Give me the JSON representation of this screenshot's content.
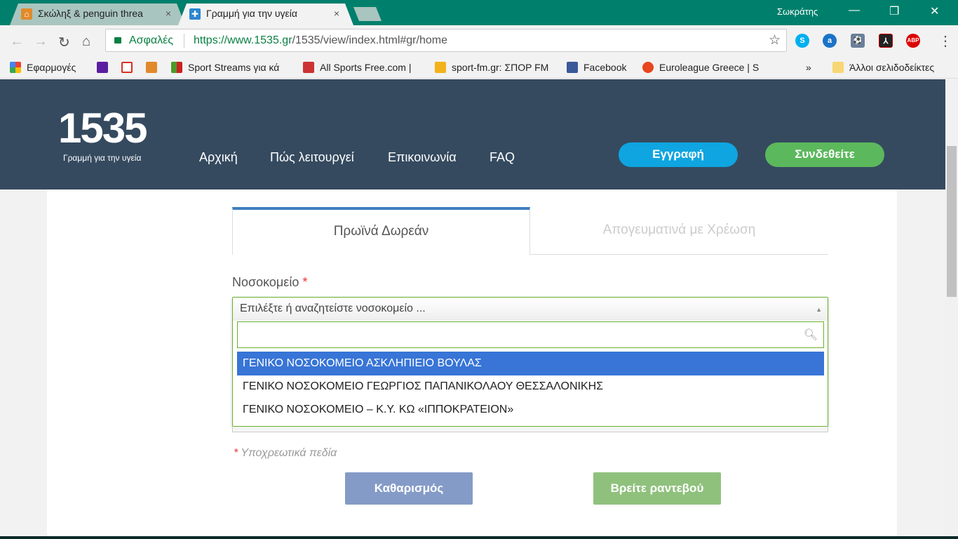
{
  "browser": {
    "tabs": [
      {
        "title": "Σκώληξ & penguin threa",
        "active": false
      },
      {
        "title": "Γραμμή για την υγεία",
        "active": true
      }
    ],
    "close_glyph": "×",
    "user": "Σωκράτης",
    "secure_label": "Ασφαλές",
    "url_host": "https://www.1535.gr",
    "url_path": "/1535/view/index.html#gr/home",
    "extensions": [
      "skype-icon",
      "a-icon",
      "soccer-icon",
      "acrobat-icon",
      "ABP"
    ],
    "bookmarks": [
      "Εφαρμογές",
      "",
      "",
      "",
      "Sport Streams για κά",
      "All Sports Free.com |",
      "sport-fm.gr: ΣΠΟΡ FM",
      "Facebook",
      "Euroleague Greece | S"
    ],
    "overflow": "»",
    "other_bookmarks": "Άλλοι σελιδοδείκτες"
  },
  "site": {
    "logo": "1535",
    "logo_sub": "Γραμμή για την υγεία",
    "menu": [
      "Αρχική",
      "Πώς λειτουργεί",
      "Επικοινωνία",
      "FAQ"
    ],
    "register": "Εγγραφή",
    "login": "Συνδεθείτε"
  },
  "form": {
    "tabs": [
      "Πρωϊνά Δωρεάν",
      "Απογευματινά με Χρέωση"
    ],
    "hospital_label": "Νοσοκομείο",
    "required_mark": "*",
    "select_placeholder": "Επιλέξτε ή αναζητείστε νοσοκομείο ...",
    "search_value": "",
    "options": [
      "ΓΕΝΙΚΟ ΝΟΣΟΚΟΜΕΙΟ ΑΣΚΛΗΠΙΕΙΟ ΒΟΥΛΑΣ",
      "ΓΕΝΙΚΟ ΝΟΣΟΚΟΜΕΙΟ ΓΕΩΡΓΙΟΣ ΠΑΠΑΝΙΚΟΛΑΟΥ ΘΕΣΣΑΛΟΝΙΚΗΣ",
      "ΓΕΝΙΚΟ ΝΟΣΟΚΟΜΕΙΟ – Κ.Υ. ΚΩ «ΙΠΠΟΚΡΑΤΕΙΟΝ»"
    ],
    "required_note": "Υποχρεωτικά πεδία",
    "clear": "Καθαρισμός",
    "find": "Βρείτε ραντεβού"
  },
  "colors": {
    "header": "#354a5f",
    "register": "#0ea5e0",
    "login": "#5cb85c",
    "clear": "#849bc7",
    "find": "#8fc17d",
    "highlight": "#3875d7"
  }
}
